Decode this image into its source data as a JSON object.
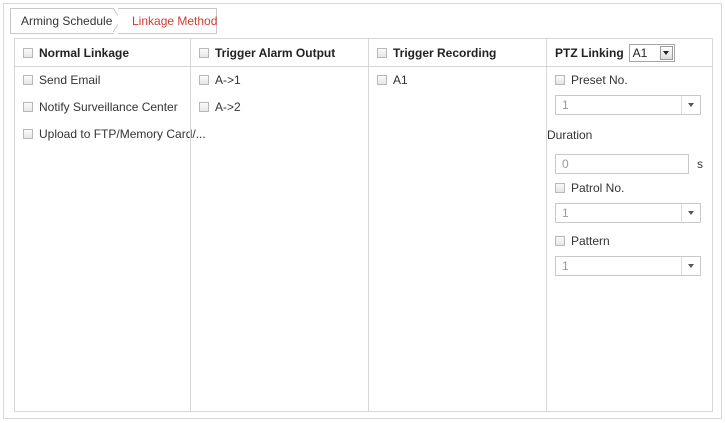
{
  "tabs": {
    "arming_schedule": "Arming Schedule",
    "linkage_method": "Linkage Method"
  },
  "colors": {
    "active_tab": "#d13b31",
    "border": "#d7d7d7"
  },
  "columns": {
    "normal": {
      "title": "Normal Linkage",
      "items": [
        "Send Email",
        "Notify Surveillance Center",
        "Upload to FTP/Memory Card/..."
      ]
    },
    "alarm_output": {
      "title": "Trigger Alarm Output",
      "items": [
        "A->1",
        "A->2"
      ]
    },
    "recording": {
      "title": "Trigger Recording",
      "items": [
        "A1"
      ]
    },
    "ptz": {
      "title": "PTZ Linking",
      "camera_select": "A1",
      "preset_label": "Preset No.",
      "preset_value": "1",
      "duration_label": "Duration",
      "duration_value": "0",
      "duration_unit": "s",
      "patrol_label": "Patrol No.",
      "patrol_value": "1",
      "pattern_label": "Pattern",
      "pattern_value": "1"
    }
  }
}
